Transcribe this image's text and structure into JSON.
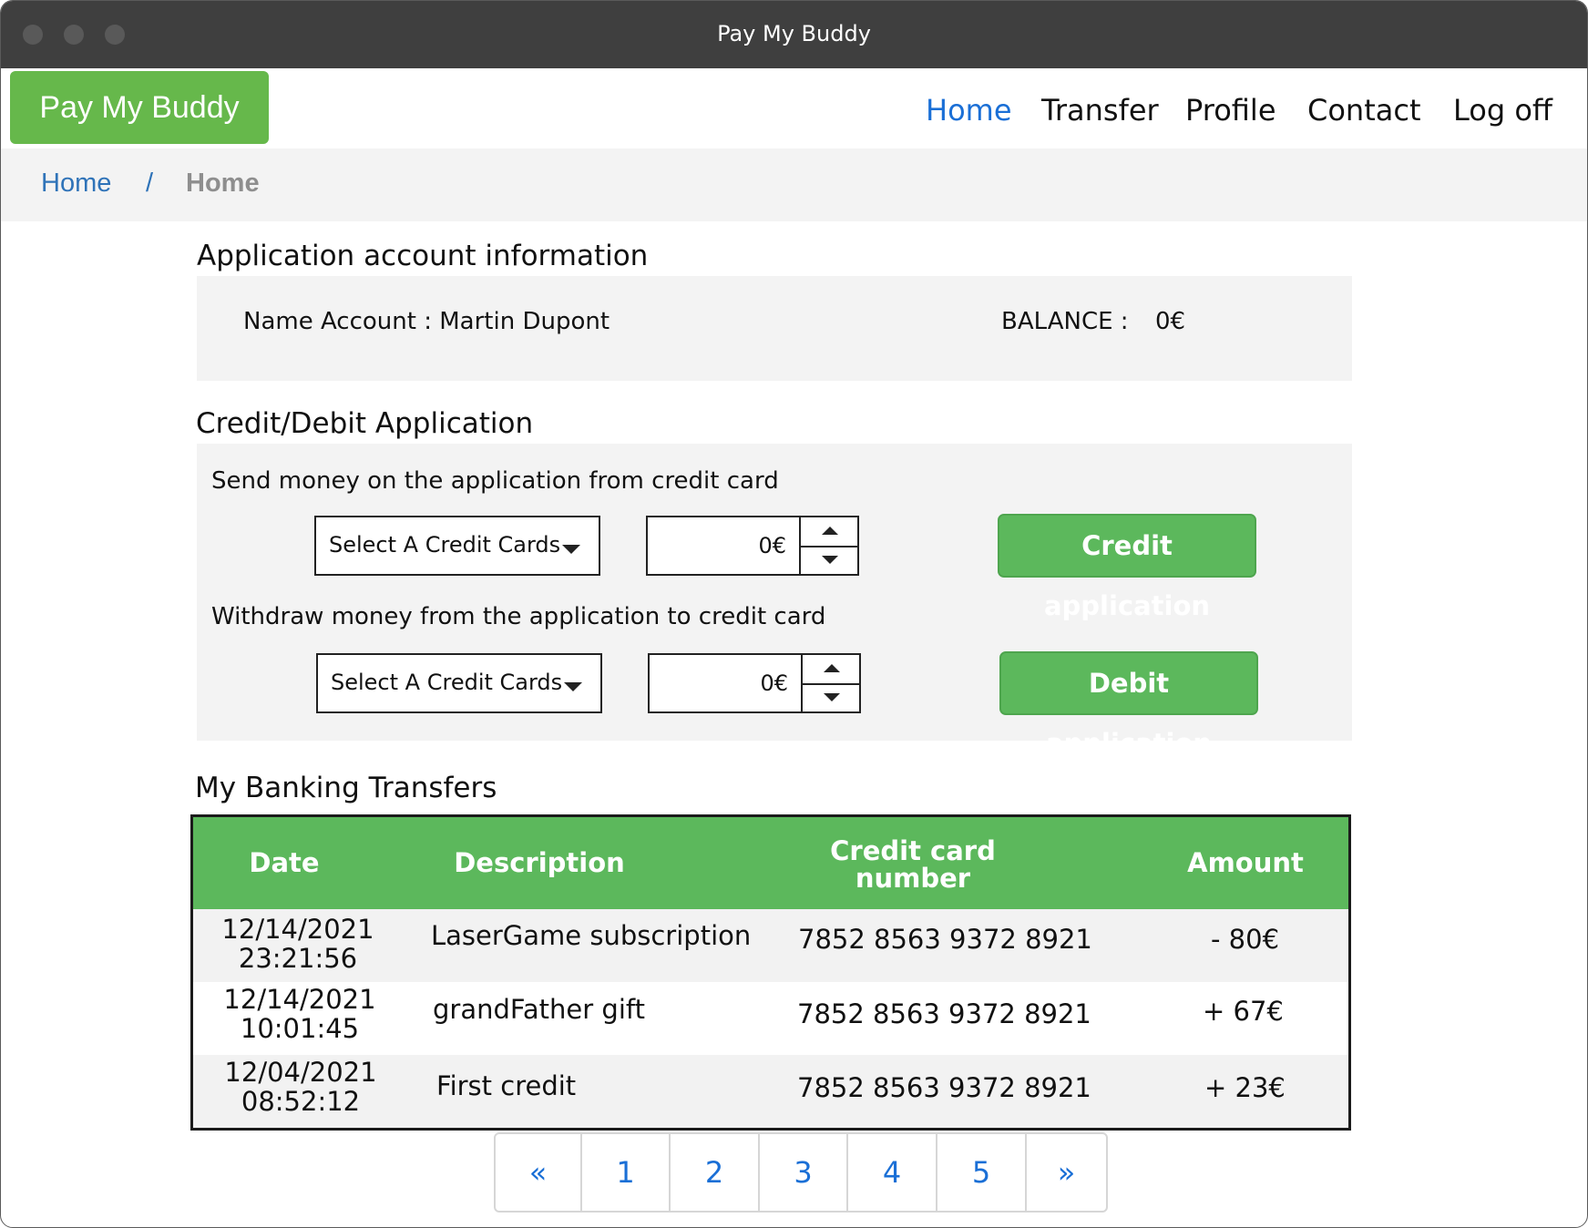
{
  "window": {
    "title": "Pay My Buddy"
  },
  "brand": {
    "logo_text": "Pay My Buddy",
    "accent": "#5cb85c"
  },
  "nav": {
    "items": [
      {
        "label": "Home",
        "active": true
      },
      {
        "label": "Transfer",
        "active": false
      },
      {
        "label": "Profile",
        "active": false
      },
      {
        "label": "Contact",
        "active": false
      },
      {
        "label": "Log off",
        "active": false
      }
    ]
  },
  "breadcrumb": {
    "home": "Home",
    "separator": "/",
    "current": "Home"
  },
  "account": {
    "title": "Application account information",
    "name_label": "Name Account : Martin Dupont",
    "balance_label": "BALANCE :",
    "balance_value": "0€"
  },
  "application": {
    "title": "Credit/Debit Application",
    "credit": {
      "label": "Send money on the application from credit card",
      "select_value": "Select A Credit Cards",
      "amount": "0€",
      "button": "Credit application"
    },
    "debit": {
      "label": "Withdraw money from the application to credit card",
      "select_value": "Select A Credit Cards",
      "amount": "0€",
      "button": "Debit application"
    }
  },
  "transfers": {
    "title": "My Banking Transfers",
    "columns": {
      "date": "Date",
      "description": "Description",
      "card_line1": "Credit card",
      "card_line2": "number",
      "amount": "Amount"
    },
    "rows": [
      {
        "date": "12/14/2021",
        "time": "23:21:56",
        "description": "LaserGame subscription",
        "card": "7852 8563 9372 8921",
        "amount": "- 80€"
      },
      {
        "date": "12/14/2021",
        "time": "10:01:45",
        "description": "grandFather gift",
        "card": "7852 8563 9372 8921",
        "amount": "+ 67€"
      },
      {
        "date": "12/04/2021",
        "time": "08:52:12",
        "description": "First credit",
        "card": "7852 8563 9372 8921",
        "amount": "+ 23€"
      }
    ]
  },
  "pagination": {
    "prev": "«",
    "pages": [
      "1",
      "2",
      "3",
      "4",
      "5"
    ],
    "next": "»"
  }
}
